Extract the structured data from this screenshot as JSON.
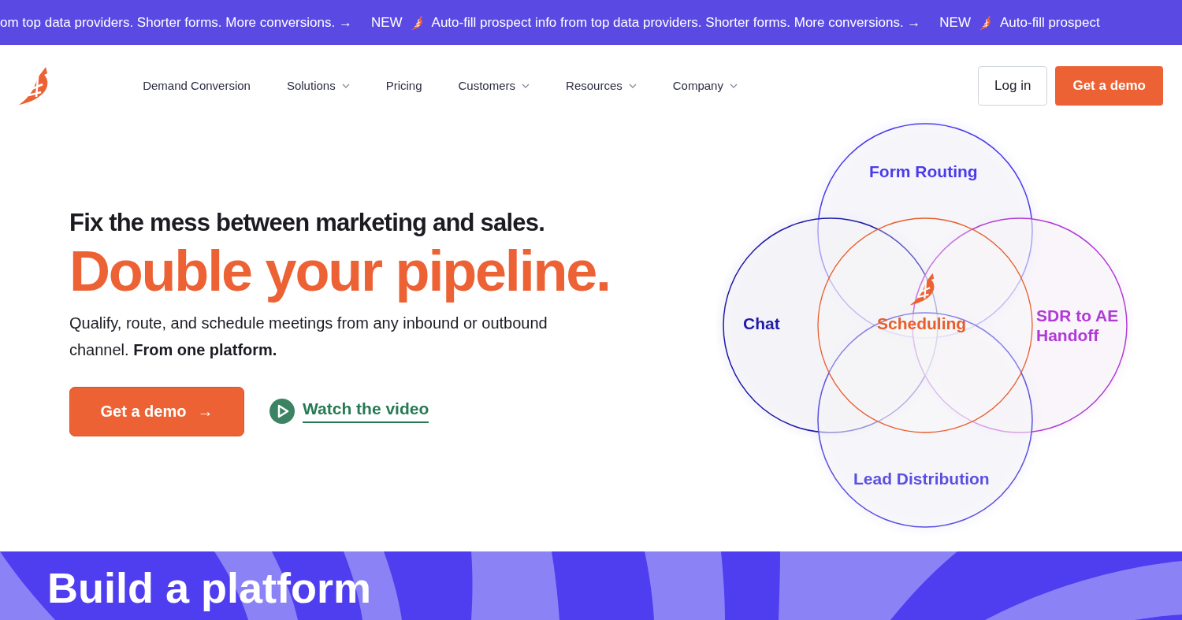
{
  "announcement_bar": {
    "segments": [
      {
        "kind": "text",
        "text": "om top data providers. Shorter forms. More conversions. →"
      },
      {
        "kind": "new",
        "text": "NEW"
      },
      {
        "kind": "text",
        "text": "Auto-fill prospect info from top data providers. Shorter forms. More conversions. →"
      },
      {
        "kind": "new",
        "text": "NEW"
      },
      {
        "kind": "text",
        "text": "Auto-fill prospect"
      }
    ]
  },
  "nav": {
    "items": [
      {
        "label": "Demand Conversion",
        "has_menu": false
      },
      {
        "label": "Solutions",
        "has_menu": true
      },
      {
        "label": "Pricing",
        "has_menu": false
      },
      {
        "label": "Customers",
        "has_menu": true
      },
      {
        "label": "Resources",
        "has_menu": true
      },
      {
        "label": "Company",
        "has_menu": true
      }
    ],
    "login": "Log in",
    "cta": "Get a demo"
  },
  "hero": {
    "eyebrow": "Fix the mess between marketing and sales.",
    "headline": "Double your pipeline.",
    "body": "Qualify, route, and schedule meetings from any inbound or outbound channel. **From one platform.**",
    "cta": "Get a demo",
    "cta_arrow": "→",
    "video_link": "Watch the video"
  },
  "diagram": {
    "center": {
      "label": "Scheduling",
      "color": "#e85d2c"
    },
    "circles": [
      {
        "label": "Form Routing",
        "color": "#4b3bea"
      },
      {
        "label": "Chat",
        "color": "#1f1aa8"
      },
      {
        "label": "SDR to AE Handoff",
        "color": "#b03ad6"
      },
      {
        "label": "Lead Distribution",
        "color": "#5b4fe0"
      }
    ]
  },
  "platform_section": {
    "heading": "Build a platform"
  }
}
